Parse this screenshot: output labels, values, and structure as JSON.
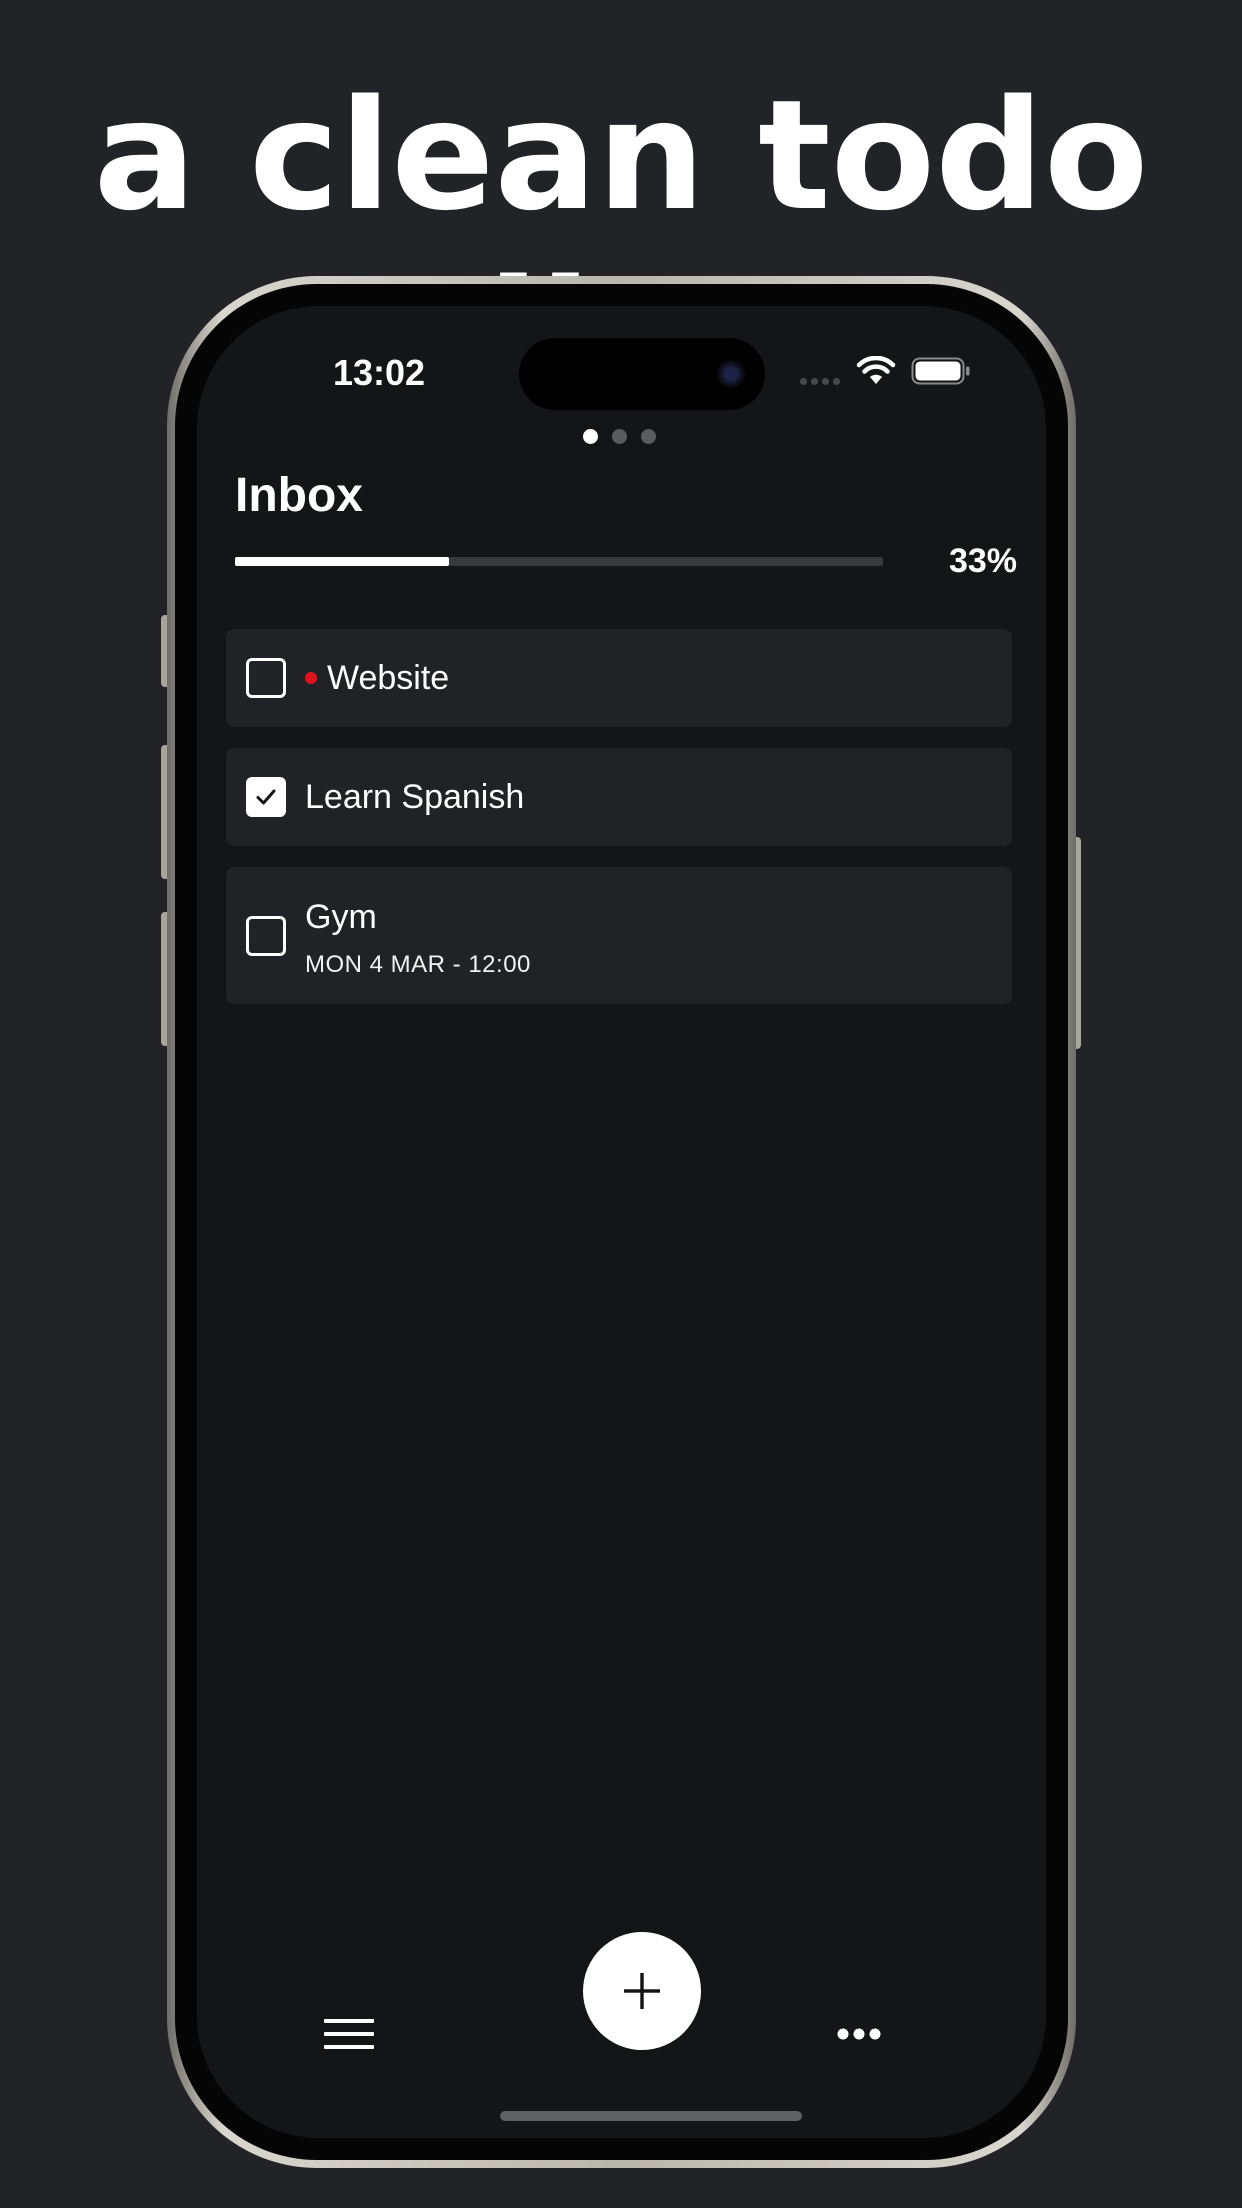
{
  "headline": "a clean todo list",
  "status_bar": {
    "time": "13:02"
  },
  "pager": {
    "pages": 3,
    "active": 1
  },
  "list": {
    "title": "Inbox",
    "progress_fraction": 0.33,
    "progress_label": "33%"
  },
  "tasks": [
    {
      "title": "Website",
      "checked": false,
      "priority_color": "#e3131c",
      "meta": ""
    },
    {
      "title": "Learn Spanish",
      "checked": true,
      "meta": ""
    },
    {
      "title": "Gym",
      "checked": false,
      "meta": "MON 4 MAR - 12:00"
    }
  ],
  "toolbar": {
    "menu_icon": "hamburger-menu-icon",
    "add_icon": "plus-icon",
    "more_icon": "ellipsis-icon"
  },
  "colors": {
    "background": "#222327",
    "screen": "#141517",
    "row": "#202226",
    "accent": "#ffffff",
    "priority": "#e3131c"
  }
}
